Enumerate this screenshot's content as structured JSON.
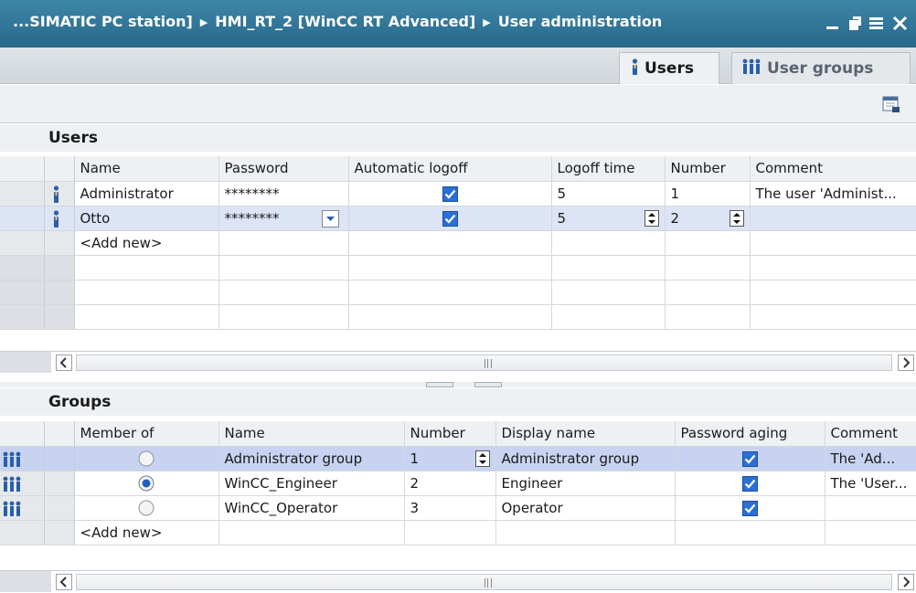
{
  "window": {
    "title_parts": [
      "...SIMATIC PC station]",
      "HMI_RT_2 [WinCC RT Advanced]",
      "User administration"
    ],
    "controls": [
      "minimize-icon",
      "restore-icon",
      "maximize-icon",
      "close-icon"
    ]
  },
  "tabs": [
    {
      "label": "Users",
      "icon": "user-icon",
      "active": true
    },
    {
      "label": "User groups",
      "icon": "group-icon",
      "active": false
    }
  ],
  "users_section": {
    "title": "Users",
    "columns": [
      "Name",
      "Password",
      "Automatic logoff",
      "Logoff time",
      "Number",
      "Comment"
    ],
    "rows": [
      {
        "name": "Administrator",
        "password": "********",
        "automatic_logoff": true,
        "logoff_time": "5",
        "number": "1",
        "comment": "The user 'Administ..."
      },
      {
        "name": "Otto",
        "password": "********",
        "automatic_logoff": true,
        "logoff_time": "5",
        "number": "2",
        "comment": ""
      }
    ],
    "add_new": "<Add new>"
  },
  "groups_section": {
    "title": "Groups",
    "columns": [
      "Member of",
      "Name",
      "Number",
      "Display name",
      "Password aging",
      "Comment"
    ],
    "rows": [
      {
        "member_of": false,
        "name": "Administrator group",
        "number": "1",
        "display_name": "Administrator group",
        "password_aging": true,
        "comment": "The 'Ad..."
      },
      {
        "member_of": true,
        "name": "WinCC_Engineer",
        "number": "2",
        "display_name": "Engineer",
        "password_aging": true,
        "comment": "The 'User..."
      },
      {
        "member_of": false,
        "name": "WinCC_Operator",
        "number": "3",
        "display_name": "Operator",
        "password_aging": true,
        "comment": ""
      }
    ],
    "add_new": "<Add new>"
  },
  "colors": {
    "titlebar": "#2f7699",
    "selection": "#dde4f6",
    "checkbox": "#2b6fd6"
  }
}
